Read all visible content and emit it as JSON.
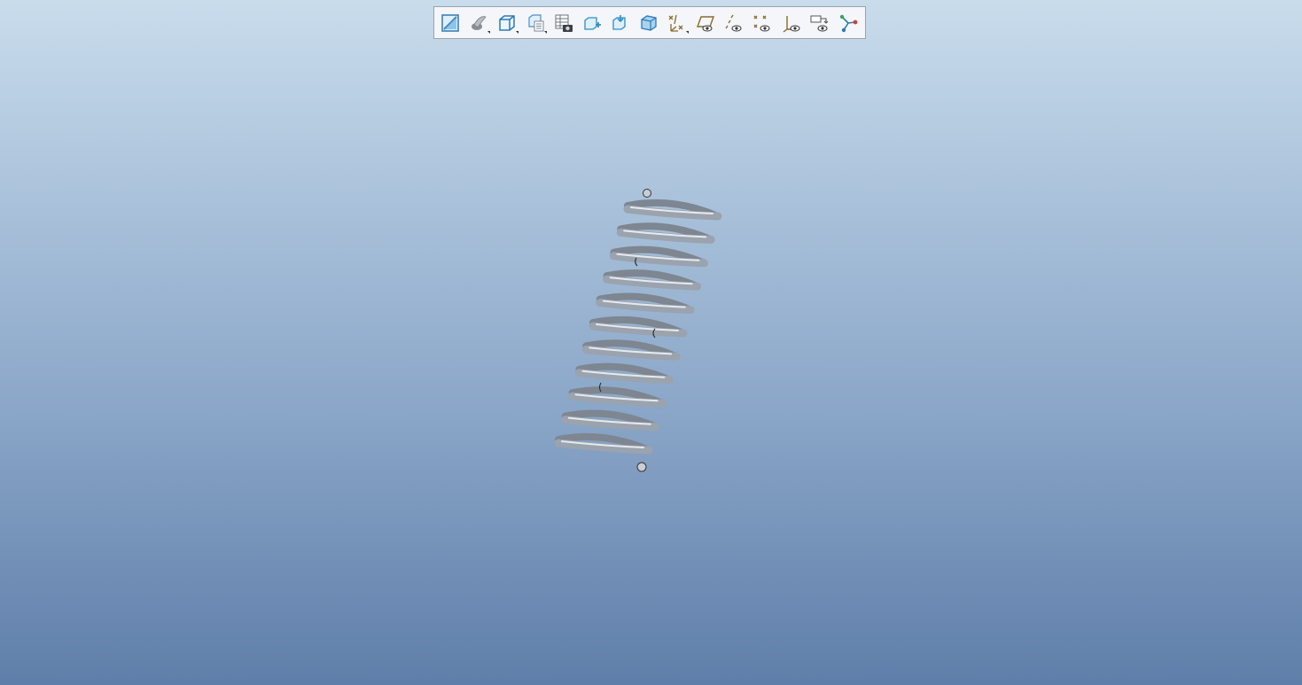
{
  "viewport": {
    "background_top": "#c9dcec",
    "background_bottom": "#5f7ea9"
  },
  "toolbar": {
    "buttons": [
      {
        "name": "refit-icon",
        "has_flyout": false
      },
      {
        "name": "display-style-icon",
        "has_flyout": true
      },
      {
        "name": "saved-orientations-icon",
        "has_flyout": true
      },
      {
        "name": "view-manager-icon",
        "has_flyout": true
      },
      {
        "name": "view-snapshot-icon",
        "has_flyout": false
      },
      {
        "name": "zoom-in-icon",
        "has_flyout": false
      },
      {
        "name": "zoom-out-icon",
        "has_flyout": false
      },
      {
        "name": "repaint-icon",
        "has_flyout": false
      },
      {
        "name": "datum-display-filters-icon",
        "has_flyout": true
      },
      {
        "name": "plane-display-icon",
        "has_flyout": false
      },
      {
        "name": "axis-display-icon",
        "has_flyout": false
      },
      {
        "name": "point-display-icon",
        "has_flyout": false
      },
      {
        "name": "csys-display-icon",
        "has_flyout": false
      },
      {
        "name": "annotation-display-icon",
        "has_flyout": false
      },
      {
        "name": "spin-center-icon",
        "has_flyout": false
      }
    ]
  },
  "model": {
    "name": "helical-spring",
    "color": "#9aa3ae",
    "coil_count": 11
  }
}
